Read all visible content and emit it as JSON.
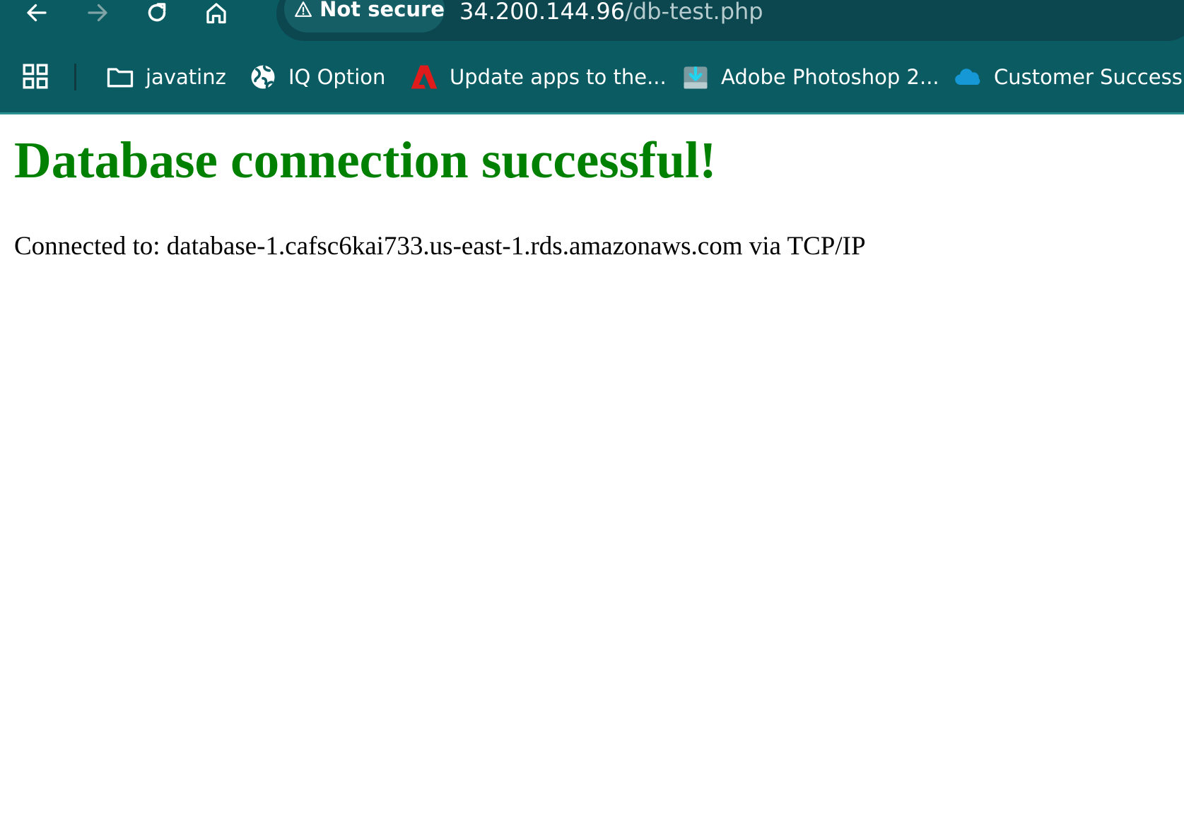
{
  "browser": {
    "security_label": "Not secure",
    "url_host": "34.200.144.96",
    "url_path": "/db-test.php"
  },
  "bookmarks": [
    {
      "label": "javatinz",
      "icon": "folder-icon"
    },
    {
      "label": "IQ Option",
      "icon": "globe-icon"
    },
    {
      "label": "Update apps to the...",
      "icon": "adobe-icon"
    },
    {
      "label": "Adobe Photoshop 2...",
      "icon": "download-icon"
    },
    {
      "label": "Customer Success S...",
      "icon": "salesforce-cloud-icon"
    }
  ],
  "page": {
    "title": "Database connection successful!",
    "status": "Connected to: database-1.cafsc6kai733.us-east-1.rds.amazonaws.com via TCP/IP"
  },
  "colors": {
    "toolbar": "#0a5b62",
    "title": "#008000",
    "adobe_red": "#e01b1b",
    "salesforce_blue": "#1798d6"
  }
}
